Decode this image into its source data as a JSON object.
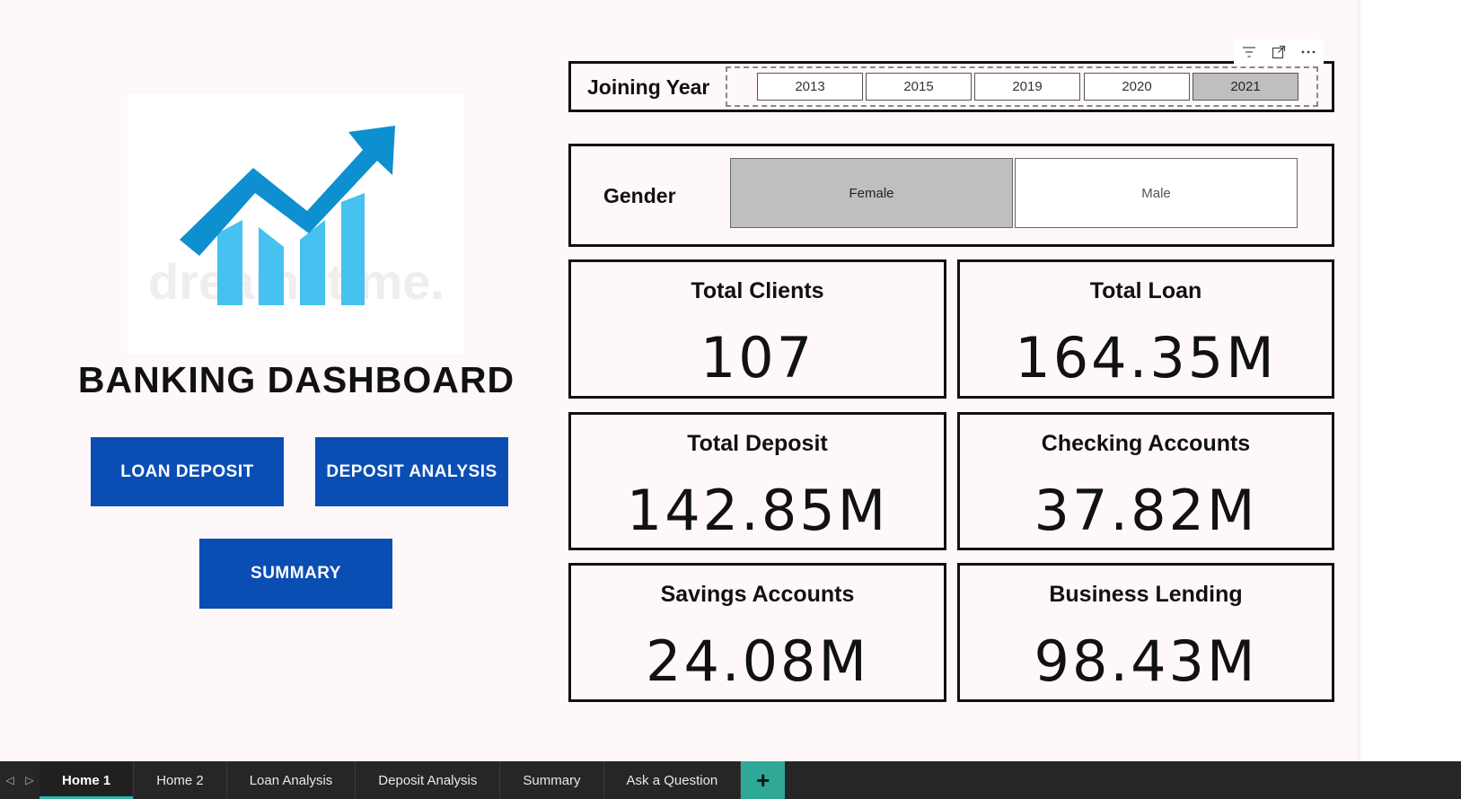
{
  "dashboard": {
    "title": "BANKING DASHBOARD",
    "logo_watermark": "dreamstime.",
    "nav_buttons": {
      "loan_deposit": "LOAN DEPOSIT",
      "deposit_analysis": "DEPOSIT ANALYSIS",
      "summary": "SUMMARY"
    }
  },
  "joining_year": {
    "label": "Joining Year",
    "options": [
      "2013",
      "2015",
      "2019",
      "2020",
      "2021"
    ],
    "selected": "2021"
  },
  "gender": {
    "label": "Gender",
    "options": [
      "Female",
      "Male"
    ],
    "selected": "Female"
  },
  "kpis": {
    "total_clients": {
      "title": "Total Clients",
      "value": "107"
    },
    "total_loan": {
      "title": "Total Loan",
      "value": "164.35M"
    },
    "total_deposit": {
      "title": "Total Deposit",
      "value": "142.85M"
    },
    "checking_accounts": {
      "title": "Checking Accounts",
      "value": "37.82M"
    },
    "savings_accounts": {
      "title": "Savings Accounts",
      "value": "24.08M"
    },
    "business_lending": {
      "title": "Business Lending",
      "value": "98.43M"
    }
  },
  "tabs": [
    "Home 1",
    "Home 2",
    "Loan Analysis",
    "Deposit Analysis",
    "Summary",
    "Ask a Question"
  ],
  "active_tab": "Home 1",
  "colors": {
    "nav_button": "#0b4eb3",
    "logo_dark": "#0d8fd0",
    "logo_light": "#45c2f0",
    "slicer_selected": "#bfbfbf",
    "tab_accent": "#2fa898"
  }
}
